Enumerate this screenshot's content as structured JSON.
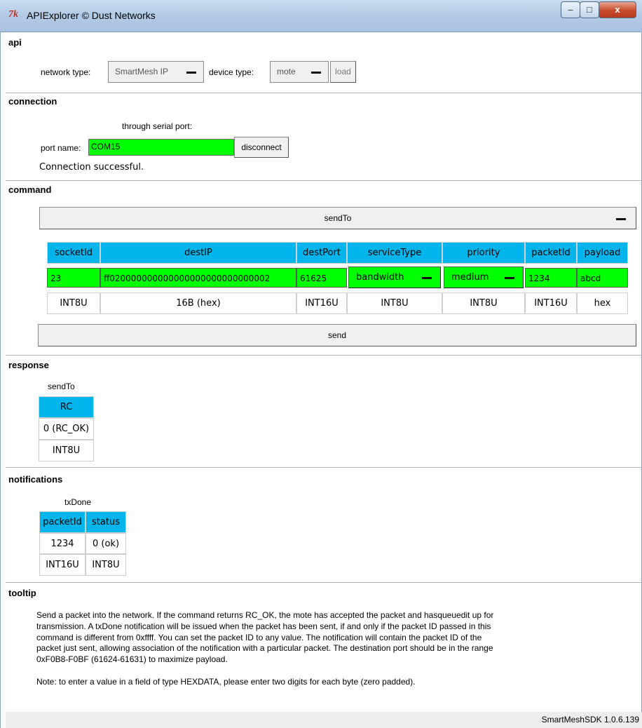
{
  "window": {
    "title": "APIExplorer © Dust Networks",
    "icon": "tk-feather-icon",
    "controls": [
      "–",
      "□",
      "x"
    ]
  },
  "api": {
    "heading": "api",
    "network_type_label": "network type:",
    "network_type_value": "SmartMesh IP",
    "device_type_label": "device type:",
    "device_type_value": "mote",
    "load_label": "load"
  },
  "connection": {
    "heading": "connection",
    "subheading": "through serial port:",
    "port_label": "port name:",
    "port_value": "COM15",
    "disconnect_label": "disconnect",
    "status": "Connection successful."
  },
  "command": {
    "heading": "command",
    "selected": "sendTo",
    "columns": [
      {
        "name": "socketId",
        "value": "23",
        "type": "INT8U",
        "kind": "input"
      },
      {
        "name": "destIP",
        "value": "ff020000000000000000000000000002",
        "type": "16B (hex)",
        "kind": "input"
      },
      {
        "name": "destPort",
        "value": "61625",
        "type": "INT16U",
        "kind": "input"
      },
      {
        "name": "serviceType",
        "value": "bandwidth",
        "type": "INT8U",
        "kind": "menu"
      },
      {
        "name": "priority",
        "value": "medium",
        "type": "INT8U",
        "kind": "menu"
      },
      {
        "name": "packetId",
        "value": "1234",
        "type": "INT16U",
        "kind": "input"
      },
      {
        "name": "payload",
        "value": "abcd",
        "type": "hex",
        "kind": "input"
      }
    ],
    "send_label": "send"
  },
  "response": {
    "heading": "response",
    "name": "sendTo",
    "columns": [
      {
        "name": "RC",
        "value": "0 (RC_OK)",
        "type": "INT8U"
      }
    ]
  },
  "notifications": {
    "heading": "notifications",
    "name": "txDone",
    "columns": [
      {
        "name": "packetId",
        "value": "1234",
        "type": "INT16U"
      },
      {
        "name": "status",
        "value": "0 (ok)",
        "type": "INT8U"
      }
    ]
  },
  "tooltip": {
    "heading": "tooltip",
    "lines": [
      "Send a packet into the network. If the command returns RC_OK, the mote has accepted the packet and hasqueuedit up for",
      "transmission. A txDone notification will be issued when the packet has been sent, if and only if the packet ID passed in this",
      "command is different from 0xffff. You can set the packet ID to any value. The notification will contain the packet ID of the",
      "packet just sent, allowing association of the notification with a particular packet. The destination port should be in the range",
      "0xF0B8-F0BF (61624-61631) to maximize payload.",
      "",
      "Note: to enter a value in a field of type HEXDATA, please enter two digits for each byte (zero padded)."
    ]
  },
  "status_bar": {
    "version": "SmartMeshSDK 1.0.6.139"
  },
  "colors": {
    "header_blue": "#00b4ec",
    "input_green": "#00ff00"
  }
}
